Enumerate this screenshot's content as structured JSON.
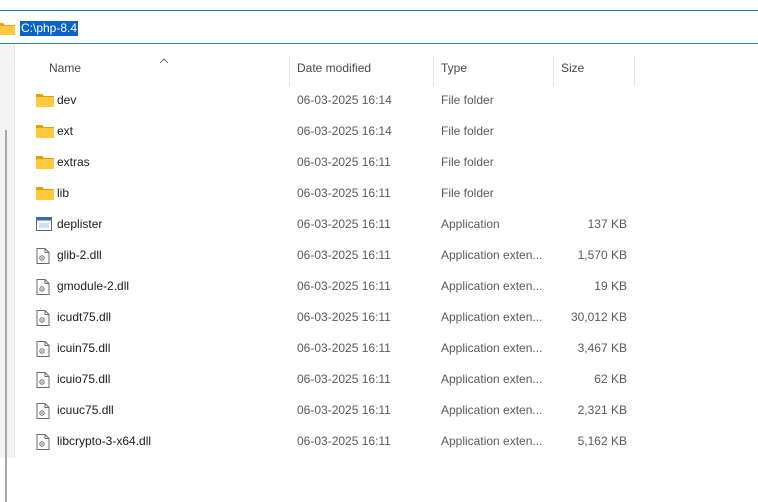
{
  "address": {
    "path": "C:\\php-8.4"
  },
  "columns": {
    "name": "Name",
    "date": "Date modified",
    "type": "Type",
    "size": "Size"
  },
  "files": [
    {
      "name": "dev",
      "date": "06-03-2025 16:14",
      "type": "File folder",
      "size": "",
      "icon": "folder-icon"
    },
    {
      "name": "ext",
      "date": "06-03-2025 16:14",
      "type": "File folder",
      "size": "",
      "icon": "folder-icon"
    },
    {
      "name": "extras",
      "date": "06-03-2025 16:11",
      "type": "File folder",
      "size": "",
      "icon": "folder-icon"
    },
    {
      "name": "lib",
      "date": "06-03-2025 16:11",
      "type": "File folder",
      "size": "",
      "icon": "folder-icon"
    },
    {
      "name": "deplister",
      "date": "06-03-2025 16:11",
      "type": "Application",
      "size": "137 KB",
      "icon": "application-icon"
    },
    {
      "name": "glib-2.dll",
      "date": "06-03-2025 16:11",
      "type": "Application exten...",
      "size": "1,570 KB",
      "icon": "dll-file-icon"
    },
    {
      "name": "gmodule-2.dll",
      "date": "06-03-2025 16:11",
      "type": "Application exten...",
      "size": "19 KB",
      "icon": "dll-file-icon"
    },
    {
      "name": "icudt75.dll",
      "date": "06-03-2025 16:11",
      "type": "Application exten...",
      "size": "30,012 KB",
      "icon": "dll-file-icon"
    },
    {
      "name": "icuin75.dll",
      "date": "06-03-2025 16:11",
      "type": "Application exten...",
      "size": "3,467 KB",
      "icon": "dll-file-icon"
    },
    {
      "name": "icuio75.dll",
      "date": "06-03-2025 16:11",
      "type": "Application exten...",
      "size": "62 KB",
      "icon": "dll-file-icon"
    },
    {
      "name": "icuuc75.dll",
      "date": "06-03-2025 16:11",
      "type": "Application exten...",
      "size": "2,321 KB",
      "icon": "dll-file-icon"
    },
    {
      "name": "libcrypto-3-x64.dll",
      "date": "06-03-2025 16:11",
      "type": "Application exten...",
      "size": "5,162 KB",
      "icon": "dll-file-icon"
    }
  ]
}
